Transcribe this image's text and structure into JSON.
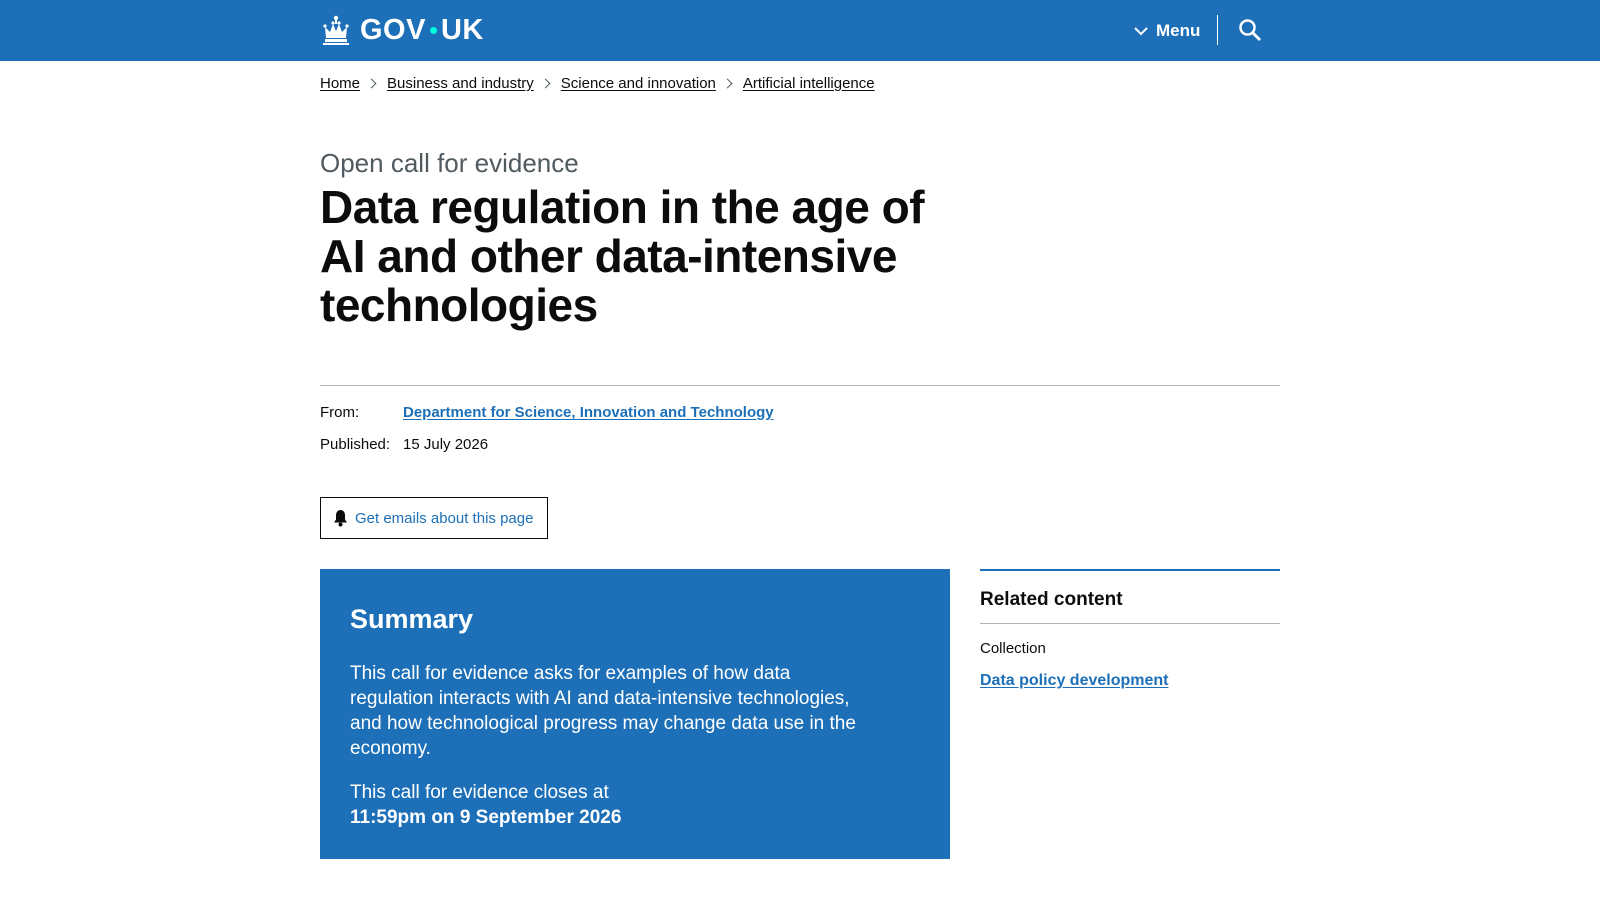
{
  "header": {
    "brand_left": "GOV",
    "brand_right": "UK",
    "menu_label": "Menu",
    "brand_color": "#1d70b8",
    "dot_color": "#00ffe0",
    "icons": [
      "crown-icon",
      "chevron-down-icon",
      "search-icon"
    ]
  },
  "breadcrumbs": [
    {
      "label": "Home"
    },
    {
      "label": "Business and industry"
    },
    {
      "label": "Science and innovation"
    },
    {
      "label": "Artificial intelligence"
    }
  ],
  "page": {
    "caption": "Open call for evidence",
    "title": "Data regulation in the age of AI and other data-intensive technologies"
  },
  "metadata": {
    "from_label": "From:",
    "from_value": "Department for Science, Innovation and Technology",
    "published_label": "Published:",
    "published_value": "15 July 2026"
  },
  "emails_button": {
    "label": "Get emails about this page",
    "icon": "bell-icon"
  },
  "summary": {
    "heading": "Summary",
    "body": "This call for evidence asks for examples of how data regulation interacts with AI and data-intensive technologies, and how technological progress may change data use in the economy.",
    "closes_intro": "This call for evidence closes at",
    "closes_date": "11:59pm on 9 September 2026"
  },
  "related": {
    "heading": "Related content",
    "collection_label": "Collection",
    "collection_link": "Data policy development"
  }
}
